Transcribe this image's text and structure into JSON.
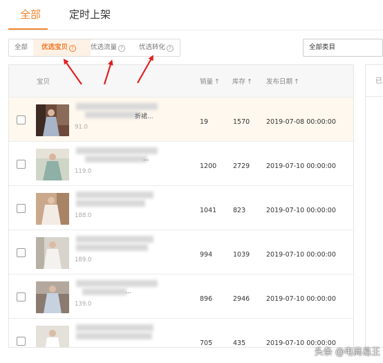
{
  "top_tabs": [
    {
      "label": "全部",
      "active": true
    },
    {
      "label": "定时上架",
      "active": false
    }
  ],
  "filters": [
    {
      "label": "全部",
      "active": false,
      "help": false
    },
    {
      "label": "优选宝贝",
      "active": true,
      "help": true
    },
    {
      "label": "优选流量",
      "active": false,
      "help": true
    },
    {
      "label": "优选转化",
      "active": false,
      "help": true
    }
  ],
  "help_glyph": "?",
  "category_select": {
    "value": "全部类目"
  },
  "table": {
    "columns": {
      "product": "宝贝",
      "sales": "销量",
      "stock": "库存",
      "publish_date": "发布日期",
      "sort_arrow": "↑"
    },
    "rows": [
      {
        "title_tail": "折裙...",
        "price": "91.0",
        "sales": "19",
        "stock": "1570",
        "date": "2019-07-08 00:00:00",
        "highlight": true
      },
      {
        "title_tail": "...",
        "price": "119.0",
        "sales": "1200",
        "stock": "2729",
        "date": "2019-07-10 00:00:00",
        "highlight": false
      },
      {
        "title_tail": "",
        "price": "188.0",
        "sales": "1041",
        "stock": "823",
        "date": "2019-07-10 00:00:00",
        "highlight": false
      },
      {
        "title_tail": "",
        "price": "189.0",
        "sales": "994",
        "stock": "1039",
        "date": "2019-07-10 00:00:00",
        "highlight": false
      },
      {
        "title_tail": "...",
        "price": "139.0",
        "sales": "896",
        "stock": "2946",
        "date": "2019-07-10 00:00:00",
        "highlight": false
      },
      {
        "title_tail": "",
        "price": "",
        "sales": "705",
        "stock": "435",
        "date": "2019-07-10 00:00:00",
        "highlight": false
      }
    ]
  },
  "side_panel": {
    "text": "已"
  },
  "watermark": "头条 @电商易王",
  "colors": {
    "accent": "#f0862f",
    "arrow": "#e02020",
    "highlight_row": "#fff8ee"
  }
}
